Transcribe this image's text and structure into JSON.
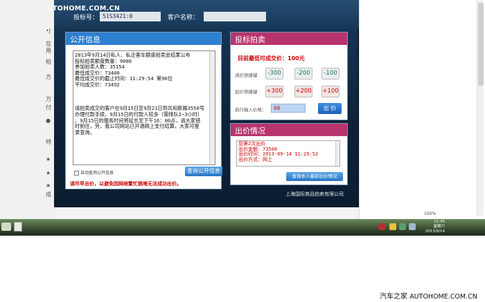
{
  "watermarks": {
    "top": "UTOHOME.COM.CN",
    "bottom_name": "汽车之家",
    "bottom_url": "AUTOHOME.COM.CN"
  },
  "browser": {
    "left_strip_items": [
      "•J",
      "在",
      "用",
      "拍",
      "方",
      "万",
      "付",
      "●",
      "特",
      "★",
      "★",
      "★",
      "成"
    ],
    "zoom_level": "100%"
  },
  "auction": {
    "header": {
      "bid_number_label": "投标号：",
      "bid_number_value": "51S3421:0",
      "customer_name_label": "客户名称："
    },
    "info_panel": {
      "title": "公开信息",
      "lines": [
        "2013年9月14日私人、私企客车额度拍卖会结果公布",
        "投标拍卖额度数量：9000",
        "参加拍卖人数：35154",
        "最低成交价：73400",
        "最低成交价的截止时间：11:29:54 第96位",
        "平均成交价：73492",
        "",
        "",
        "",
        "请拍卖成交的客户在9月15日至9月21日到共和新路3550号",
        "办理付款手续，9月15日的付款人较多（需排队2~3小时）",
        "。9月15日的服务时间将延长至下午16：00点，请大家错",
        "时前往，另，我公司网站已开通网上支付结算，大家可登",
        "录查询。"
      ],
      "auto_query_label": "自动查询公开信息",
      "query_button": "查询公开信息",
      "warning": "请尽早出价，以避免因网络繁忙拥堵无法成功出价。"
    },
    "bid_panel": {
      "title": "投标拍卖",
      "lowest_price": "目前最低可成交价：100元",
      "decrease_label": "减价快捷键",
      "increase_label": "加价快捷键",
      "decrease_buttons": [
        "-300",
        "-200",
        "-100"
      ],
      "increase_buttons": [
        "+300",
        "+200",
        "+100"
      ],
      "custom_label": "自行输入价格：",
      "custom_value": "66",
      "submit_button": "出 价"
    },
    "status_panel": {
      "title": "出价情况",
      "lines": [
        "您第2次出价",
        "出价金额：73500",
        "出价时间：2013-09-14 11:29:52",
        "出价方式：网上"
      ],
      "query_button": "查询本人最新出价情况"
    },
    "footer": "上海国际商品拍卖有限公司"
  },
  "taskbar": {
    "time": "11:45",
    "weekday": "星期六",
    "date": "2013/9/14"
  },
  "colors": {
    "window_bg": "#0d2238",
    "info_header": "#2d7fcf",
    "bid_header": "#b8346c",
    "highlight_red": "#cc0000",
    "button_blue": "#2a76c4"
  }
}
